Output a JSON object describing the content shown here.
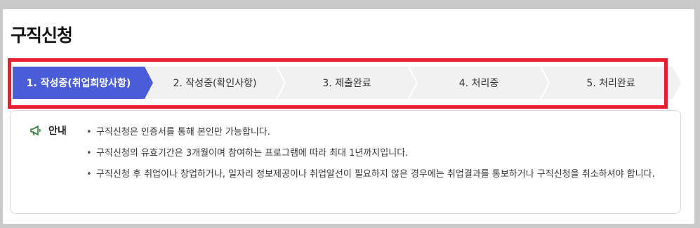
{
  "page": {
    "title": "구직신청"
  },
  "stepper": {
    "active_index": 0,
    "colors": {
      "active": "#4a5dd9",
      "inactive": "#f1f1f1",
      "chevron": "#ffffff"
    },
    "steps": [
      {
        "label": "1. 작성중(취업희망사항)"
      },
      {
        "label": "2. 작성중(확인사항)"
      },
      {
        "label": "3. 제출완료"
      },
      {
        "label": "4. 처리중"
      },
      {
        "label": "5. 처리완료"
      }
    ]
  },
  "notice": {
    "icon": "megaphone-icon",
    "title": "안내",
    "items": [
      "구직신청은 인증서를 통해 본인만 가능합니다.",
      "구직신청의 유효기간은 3개월이며 참여하는 프로그램에 따라 최대 1년까지입니다.",
      "구직신청 후 취업이나 창업하거나, 일자리 정보제공이나 취업알선이 필요하지 않은 경우에는 취업결과를 통보하거나 구직신청을 취소하셔야 합니다."
    ]
  },
  "highlight_color": "#ea1d2c"
}
